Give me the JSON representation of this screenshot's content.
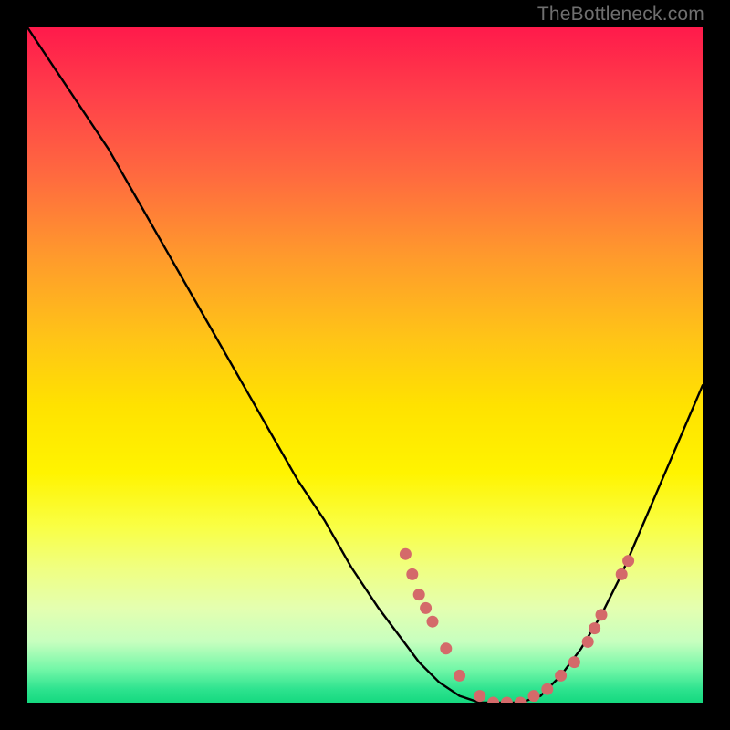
{
  "watermark": "TheBottleneck.com",
  "chart_data": {
    "type": "line",
    "title": "",
    "xlabel": "",
    "ylabel": "",
    "xlim": [
      0,
      100
    ],
    "ylim": [
      0,
      100
    ],
    "series": [
      {
        "name": "bottleneck-curve",
        "x": [
          0,
          4,
          8,
          12,
          16,
          20,
          24,
          28,
          32,
          36,
          40,
          44,
          48,
          52,
          55,
          58,
          61,
          64,
          67,
          70,
          73,
          76,
          79,
          82,
          85,
          88,
          91,
          94,
          97,
          100
        ],
        "y": [
          100,
          94,
          88,
          82,
          75,
          68,
          61,
          54,
          47,
          40,
          33,
          27,
          20,
          14,
          10,
          6,
          3,
          1,
          0,
          0,
          0,
          1,
          4,
          8,
          13,
          19,
          26,
          33,
          40,
          47
        ]
      }
    ],
    "markers": {
      "name": "highlight-points",
      "color": "#d46a6a",
      "points": [
        {
          "x": 56,
          "y": 22
        },
        {
          "x": 57,
          "y": 19
        },
        {
          "x": 58,
          "y": 16
        },
        {
          "x": 59,
          "y": 14
        },
        {
          "x": 60,
          "y": 12
        },
        {
          "x": 62,
          "y": 8
        },
        {
          "x": 64,
          "y": 4
        },
        {
          "x": 67,
          "y": 1
        },
        {
          "x": 69,
          "y": 0
        },
        {
          "x": 71,
          "y": 0
        },
        {
          "x": 73,
          "y": 0
        },
        {
          "x": 75,
          "y": 1
        },
        {
          "x": 77,
          "y": 2
        },
        {
          "x": 79,
          "y": 4
        },
        {
          "x": 81,
          "y": 6
        },
        {
          "x": 83,
          "y": 9
        },
        {
          "x": 84,
          "y": 11
        },
        {
          "x": 85,
          "y": 13
        },
        {
          "x": 88,
          "y": 19
        },
        {
          "x": 89,
          "y": 21
        }
      ]
    }
  }
}
